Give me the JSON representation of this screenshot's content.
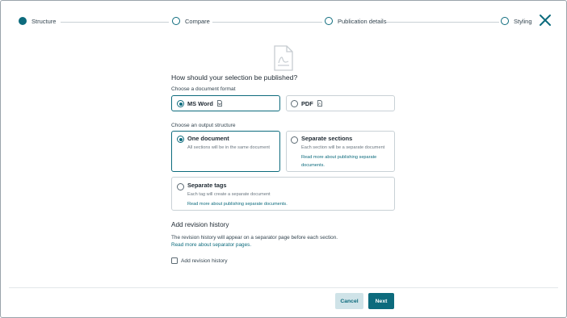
{
  "stepper": {
    "steps": [
      {
        "label": "Structure",
        "active": true
      },
      {
        "label": "Compare",
        "active": false
      },
      {
        "label": "Publication details",
        "active": false
      },
      {
        "label": "Styling",
        "active": false
      }
    ],
    "close_icon": "close-icon"
  },
  "header_icon": "document-icon",
  "main": {
    "heading": "How should your selection be published?",
    "format_label": "Choose a document format",
    "formats": [
      {
        "label": "MS Word",
        "selected": true,
        "icon": "word-file-icon"
      },
      {
        "label": "PDF",
        "selected": false,
        "icon": "pdf-file-icon"
      }
    ],
    "structure_label": "Choose an output structure",
    "structures": [
      {
        "title": "One document",
        "desc": "All sections will be in the same document",
        "selected": true
      },
      {
        "title": "Separate sections",
        "desc": "Each section will be a separate document",
        "link_line1": "Read more about publishing separate",
        "link_line2": "documents.",
        "selected": false
      },
      {
        "title": "Separate tags",
        "desc": "Each tag will create a separate document",
        "link": "Read more about publishing separate documents.",
        "selected": false
      }
    ],
    "revision": {
      "title": "Add revision history",
      "text": "The revision history will appear on a separator page before each section.",
      "link": "Read more about separator pages.",
      "checkbox_label": "Add revision history",
      "checked": false
    }
  },
  "footer": {
    "cancel_label": "Cancel",
    "next_label": "Next"
  },
  "colors": {
    "accent": "#0d6b7d",
    "cancel_bg": "#cfe3e8",
    "border": "#c9d1d6"
  }
}
